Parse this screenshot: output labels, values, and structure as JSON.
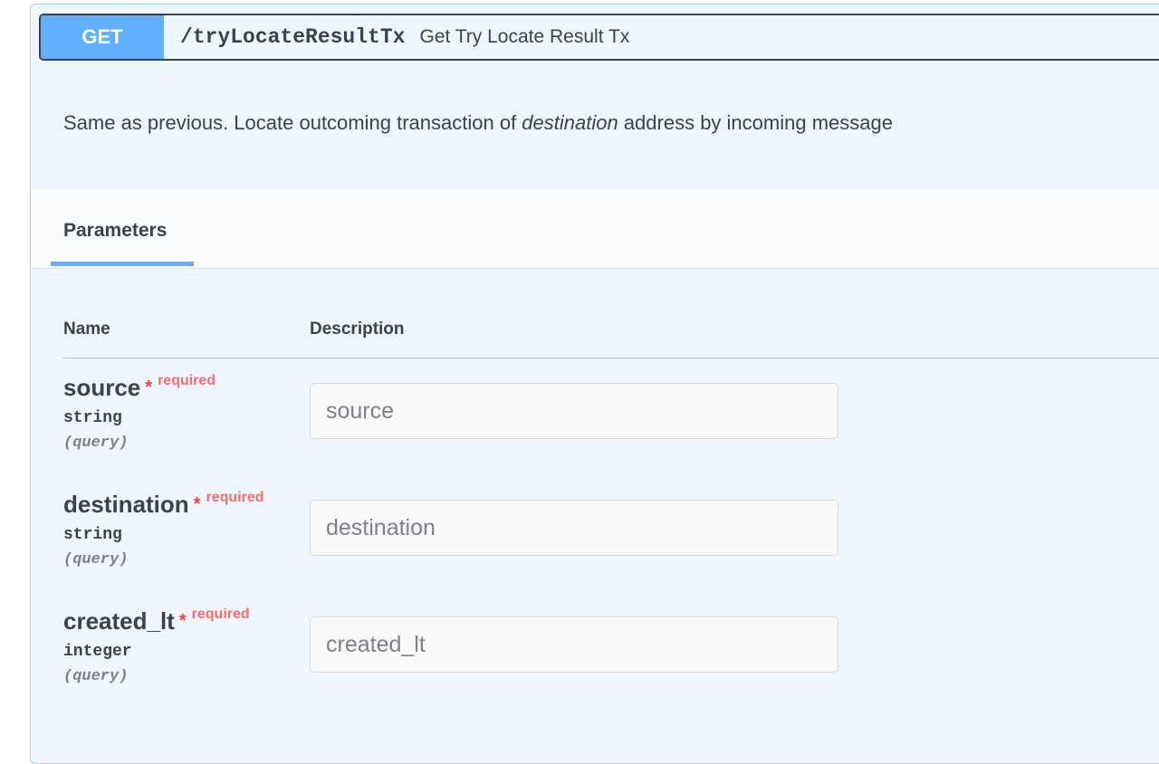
{
  "operation": {
    "method": "GET",
    "path": "/tryLocateResultTx",
    "summary": "Get Try Locate Result Tx",
    "description": {
      "before": "Same as previous. Locate outcoming transaction of ",
      "emphasis": "destination",
      "after": " address by incoming message"
    }
  },
  "tabs": {
    "parameters_label": "Parameters"
  },
  "table": {
    "col_name": "Name",
    "col_description": "Description"
  },
  "parameters": [
    {
      "name": "source",
      "required_mark": "*",
      "required_label": "required",
      "type": "string",
      "in": "(query)",
      "placeholder": "source",
      "value": ""
    },
    {
      "name": "destination",
      "required_mark": "*",
      "required_label": "required",
      "type": "string",
      "in": "(query)",
      "placeholder": "destination",
      "value": ""
    },
    {
      "name": "created_lt",
      "required_mark": "*",
      "required_label": "required",
      "type": "integer",
      "in": "(query)",
      "placeholder": "created_lt",
      "value": ""
    }
  ],
  "colors": {
    "get_method": "#61affe",
    "block_background": "#eff6fd",
    "block_border": "#9fcdf3",
    "required": "#f93e3e",
    "text": "#3b4151"
  }
}
